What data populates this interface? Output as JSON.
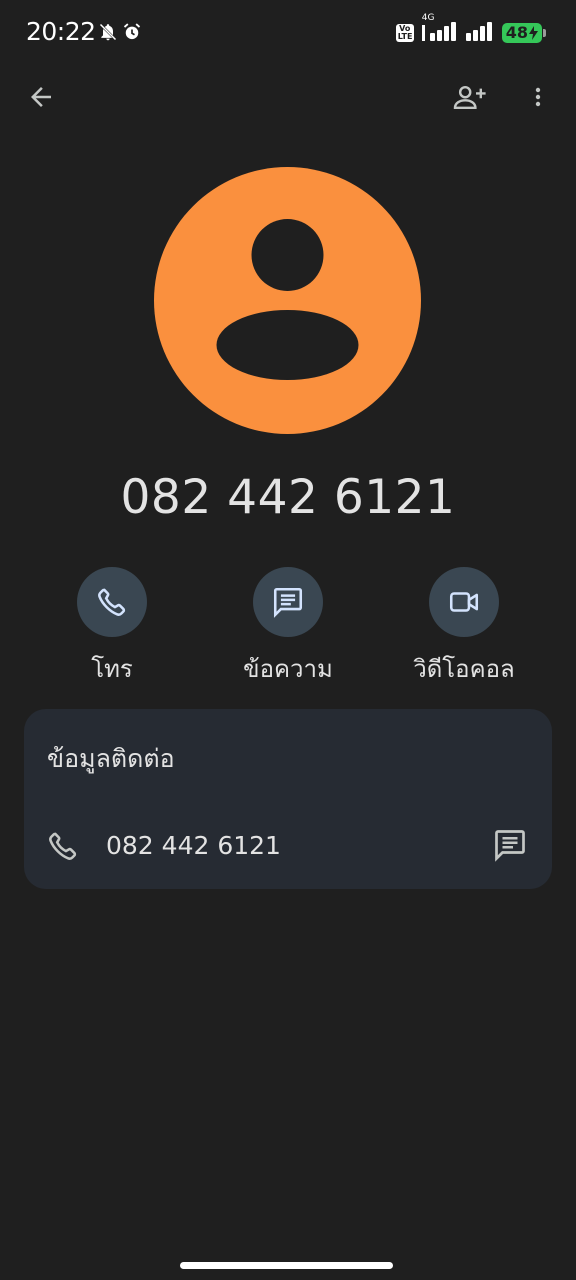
{
  "status_bar": {
    "time": "20:22",
    "net_type": "4G",
    "volte": "Vo LTE",
    "battery": "48"
  },
  "top_bar": {
    "back_icon": "arrow-back-icon",
    "add_contact_icon": "person-add-icon",
    "more_icon": "more-vert-icon"
  },
  "contact": {
    "avatar_color": "#fa903e",
    "title": "082 442 6121"
  },
  "actions": [
    {
      "icon": "phone-icon",
      "label": "โทร"
    },
    {
      "icon": "message-icon",
      "label": "ข้อความ"
    },
    {
      "icon": "videocam-icon",
      "label": "วิดีโอคอล"
    }
  ],
  "contact_info": {
    "title": "ข้อมูลติดต่อ",
    "number": "082 442 6121"
  },
  "colors": {
    "background": "#1f1f1f",
    "action_circle": "#3a4752",
    "card": "#262b33",
    "battery": "#35c759"
  }
}
